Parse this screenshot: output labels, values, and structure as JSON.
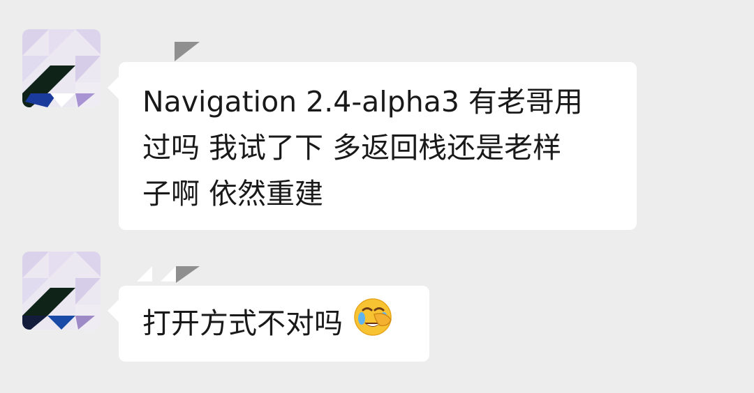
{
  "chat": {
    "messages": [
      {
        "sender": "other",
        "text": "Navigation 2.4-alpha3 有老哥用\n过吗 我试了下 多返回栈还是老样\n子啊 依然重建"
      },
      {
        "sender": "other",
        "text": "打开方式不对吗",
        "emoji": "face-with-tears-of-joy-covering-face-icon"
      }
    ]
  },
  "colors": {
    "background": "#ededed",
    "bubble": "#ffffff",
    "text": "#191919"
  }
}
